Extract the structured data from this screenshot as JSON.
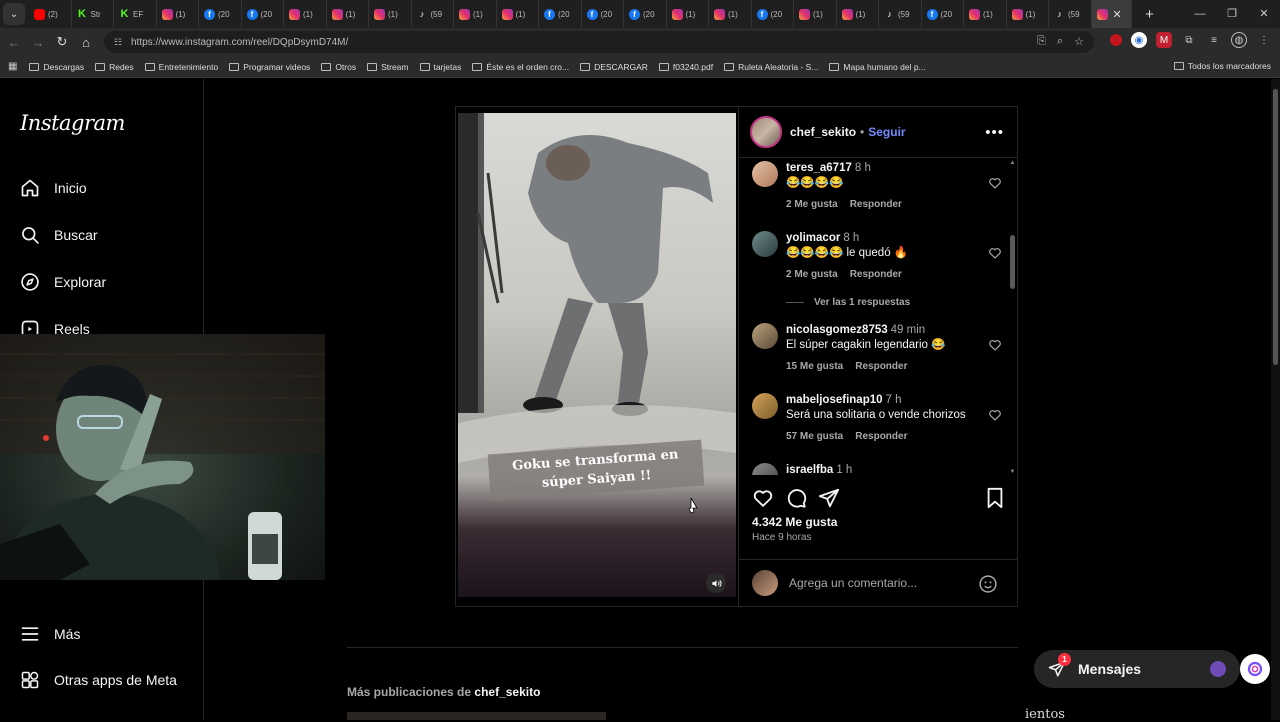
{
  "browser": {
    "tabs": [
      {
        "icon": "youtube-icon",
        "kind": "yt",
        "glyph": "",
        "label": "(2)"
      },
      {
        "icon": "kick-icon",
        "kind": "kick",
        "glyph": "K",
        "label": "Str"
      },
      {
        "icon": "kick-icon",
        "kind": "kick",
        "glyph": "K",
        "label": "EF"
      },
      {
        "icon": "instagram-icon",
        "kind": "ig",
        "glyph": "",
        "label": "(1)"
      },
      {
        "icon": "facebook-icon",
        "kind": "fb",
        "glyph": "f",
        "label": "(20"
      },
      {
        "icon": "facebook-icon",
        "kind": "fb",
        "glyph": "f",
        "label": "(20"
      },
      {
        "icon": "instagram-icon",
        "kind": "ig",
        "glyph": "",
        "label": "(1)"
      },
      {
        "icon": "instagram-icon",
        "kind": "ig",
        "glyph": "",
        "label": "(1)"
      },
      {
        "icon": "instagram-icon",
        "kind": "ig",
        "glyph": "",
        "label": "(1)"
      },
      {
        "icon": "tiktok-icon",
        "kind": "tk",
        "glyph": "♪",
        "label": "(59"
      },
      {
        "icon": "instagram-icon",
        "kind": "ig",
        "glyph": "",
        "label": "(1)"
      },
      {
        "icon": "instagram-icon",
        "kind": "ig",
        "glyph": "",
        "label": "(1)"
      },
      {
        "icon": "facebook-icon",
        "kind": "fb",
        "glyph": "f",
        "label": "(20"
      },
      {
        "icon": "facebook-icon",
        "kind": "fb",
        "glyph": "f",
        "label": "(20"
      },
      {
        "icon": "facebook-icon",
        "kind": "fb",
        "glyph": "f",
        "label": "(20"
      },
      {
        "icon": "instagram-icon",
        "kind": "ig",
        "glyph": "",
        "label": "(1)"
      },
      {
        "icon": "instagram-icon",
        "kind": "ig",
        "glyph": "",
        "label": "(1)"
      },
      {
        "icon": "facebook-icon",
        "kind": "fb",
        "glyph": "f",
        "label": "(20"
      },
      {
        "icon": "instagram-icon",
        "kind": "ig",
        "glyph": "",
        "label": "(1)"
      },
      {
        "icon": "instagram-icon",
        "kind": "ig",
        "glyph": "",
        "label": "(1)"
      },
      {
        "icon": "tiktok-icon",
        "kind": "tk",
        "glyph": "♪",
        "label": "(59"
      },
      {
        "icon": "facebook-icon",
        "kind": "fb",
        "glyph": "f",
        "label": "(20"
      },
      {
        "icon": "instagram-icon",
        "kind": "ig",
        "glyph": "",
        "label": "(1)"
      },
      {
        "icon": "instagram-icon",
        "kind": "ig",
        "glyph": "",
        "label": "(1)"
      },
      {
        "icon": "tiktok-icon",
        "kind": "tk",
        "glyph": "♪",
        "label": "(59"
      }
    ],
    "url": "https://www.instagram.com/reel/DQpDsymD74M/",
    "bookmarks": [
      "Descargas",
      "Redes",
      "Entretenimiento",
      "Programar videos",
      "Otros",
      "Stream",
      "tarjetas",
      "Éste es el orden cro...",
      "DESCARGAR",
      "f03240.pdf",
      "Ruleta Aleatoria - S...",
      "Mapa humano del p..."
    ],
    "all_bookmarks": "Todos los marcadores"
  },
  "sidebar": {
    "logo": "Instagram",
    "items": [
      {
        "label": "Inicio",
        "icon": "home-icon"
      },
      {
        "label": "Buscar",
        "icon": "search-icon"
      },
      {
        "label": "Explorar",
        "icon": "compass-icon"
      },
      {
        "label": "Reels",
        "icon": "reels-icon"
      },
      {
        "label": "Más",
        "icon": "menu-icon"
      },
      {
        "label": "Otras apps de Meta",
        "icon": "apps-icon"
      }
    ]
  },
  "post": {
    "username": "chef_sekito",
    "follow_label": "Seguir",
    "video_caption": "Goku se transforma en súper Saiyan !!",
    "likes": "4.342 Me gusta",
    "time_ago": "Hace 9 horas",
    "comment_placeholder": "Agrega un comentario...",
    "comments": [
      {
        "user": "teres_a6717",
        "time": "8 h",
        "text": "😂😂😂😂",
        "likes": "2 Me gusta",
        "reply": "Responder"
      },
      {
        "user": "yolimacor",
        "time": "8 h",
        "text": "😂😂😂😂 le quedó 🔥",
        "likes": "2 Me gusta",
        "reply": "Responder"
      },
      {
        "user": "nicolasgomez8753",
        "time": "49 min",
        "text": "El súper cagakin legendario 😂",
        "likes": "15 Me gusta",
        "reply": "Responder"
      },
      {
        "user": "mabeljosefinap10",
        "time": "7 h",
        "text": "Será una solitaria o vende chorizos",
        "likes": "57 Me gusta",
        "reply": "Responder"
      },
      {
        "user": "israelfba",
        "time": "1 h",
        "text": "",
        "likes": "",
        "reply": ""
      }
    ],
    "view_replies": "Ver las 1 respuestas"
  },
  "more_posts": {
    "prefix": "Más publicaciones de",
    "user": "chef_sekito"
  },
  "partial_text": "ientos",
  "messages": {
    "label": "Mensajes",
    "badge": "1"
  }
}
